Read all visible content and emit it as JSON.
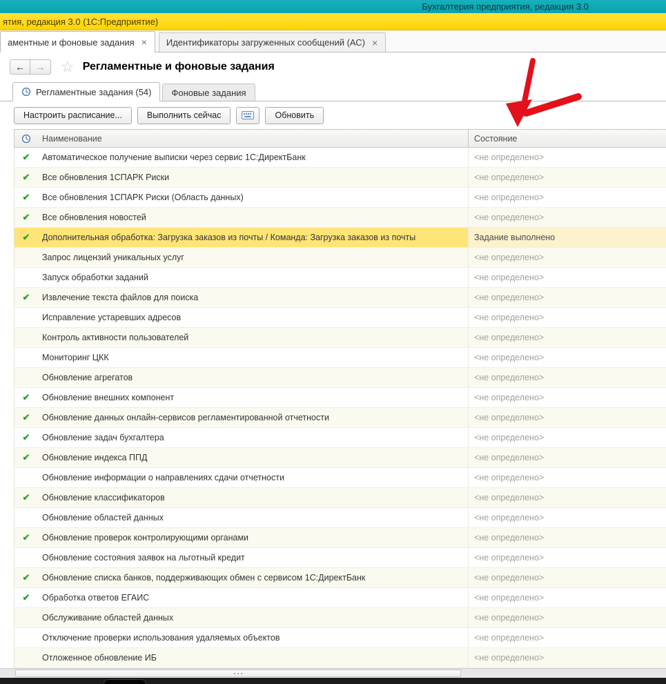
{
  "titlebar": {
    "app_title": "Бухгалтерия предприятия, редакция 3.0",
    "window_title": "ятия, редакция 3.0  (1С:Предприятие)"
  },
  "icons": {
    "back": "←",
    "forward": "→",
    "star": "☆"
  },
  "tabs": [
    {
      "label": "аментные и фоновые задания",
      "close": "×",
      "active": true
    },
    {
      "label": "Идентификаторы загруженных сообщений (АС)",
      "close": "×",
      "active": false
    }
  ],
  "page": {
    "title": "Регламентные и фоновые задания"
  },
  "subtabs": [
    {
      "label": "Регламентные задания (54)",
      "active": true
    },
    {
      "label": "Фоновые задания",
      "active": false
    }
  ],
  "toolbar": {
    "configure_schedule": "Настроить расписание...",
    "run_now": "Выполнить сейчас",
    "refresh": "Обновить"
  },
  "table": {
    "columns": {
      "name": "Наименование",
      "state": "Состояние"
    },
    "check_glyph": "✔",
    "default_state": "<не определено>",
    "rows": [
      {
        "name": "Автоматическое получение выписки через сервис 1С:ДиректБанк",
        "checked": true,
        "state": "<не определено>",
        "highlighted": false
      },
      {
        "name": "Все обновления 1СПАРК Риски",
        "checked": true,
        "state": "<не определено>",
        "highlighted": false
      },
      {
        "name": "Все обновления 1СПАРК Риски (Область данных)",
        "checked": true,
        "state": "<не определено>",
        "highlighted": false
      },
      {
        "name": "Все обновления новостей",
        "checked": true,
        "state": "<не определено>",
        "highlighted": false
      },
      {
        "name": "Дополнительная обработка: Загрузка заказов из почты / Команда: Загрузка заказов из почты",
        "checked": true,
        "state": "Задание выполнено",
        "highlighted": true
      },
      {
        "name": "Запрос лицензий уникальных услуг",
        "checked": false,
        "state": "<не определено>",
        "highlighted": false
      },
      {
        "name": "Запуск обработки заданий",
        "checked": false,
        "state": "<не определено>",
        "highlighted": false
      },
      {
        "name": "Извлечение текста файлов для поиска",
        "checked": true,
        "state": "<не определено>",
        "highlighted": false
      },
      {
        "name": "Исправление устаревших адресов",
        "checked": false,
        "state": "<не определено>",
        "highlighted": false
      },
      {
        "name": "Контроль активности пользователей",
        "checked": false,
        "state": "<не определено>",
        "highlighted": false
      },
      {
        "name": "Мониторинг ЦКК",
        "checked": false,
        "state": "<не определено>",
        "highlighted": false
      },
      {
        "name": "Обновление агрегатов",
        "checked": false,
        "state": "<не определено>",
        "highlighted": false
      },
      {
        "name": "Обновление внешних компонент",
        "checked": true,
        "state": "<не определено>",
        "highlighted": false
      },
      {
        "name": "Обновление данных онлайн-сервисов регламентированной отчетности",
        "checked": true,
        "state": "<не определено>",
        "highlighted": false
      },
      {
        "name": "Обновление задач бухгалтера",
        "checked": true,
        "state": "<не определено>",
        "highlighted": false
      },
      {
        "name": "Обновление индекса ППД",
        "checked": true,
        "state": "<не определено>",
        "highlighted": false
      },
      {
        "name": "Обновление информации о направлениях сдачи отчетности",
        "checked": false,
        "state": "<не определено>",
        "highlighted": false
      },
      {
        "name": "Обновление классификаторов",
        "checked": true,
        "state": "<не определено>",
        "highlighted": false
      },
      {
        "name": "Обновление областей данных",
        "checked": false,
        "state": "<не определено>",
        "highlighted": false
      },
      {
        "name": "Обновление проверок контролирующими органами",
        "checked": true,
        "state": "<не определено>",
        "highlighted": false
      },
      {
        "name": "Обновление состояния заявок на льготный кредит",
        "checked": false,
        "state": "<не определено>",
        "highlighted": false
      },
      {
        "name": "Обновление списка банков, поддерживающих обмен с сервисом 1С:ДиректБанк",
        "checked": true,
        "state": "<не определено>",
        "highlighted": false
      },
      {
        "name": "Обработка ответов ЕГАИС",
        "checked": true,
        "state": "<не определено>",
        "highlighted": false
      },
      {
        "name": "Обслуживание областей данных",
        "checked": false,
        "state": "<не определено>",
        "highlighted": false
      },
      {
        "name": "Отключение проверки использования удаляемых объектов",
        "checked": false,
        "state": "<не определено>",
        "highlighted": false
      },
      {
        "name": "Отложенное обновление ИБ",
        "checked": false,
        "state": "<не определено>",
        "highlighted": false
      }
    ]
  },
  "annotation": {
    "color": "#e2111c"
  }
}
